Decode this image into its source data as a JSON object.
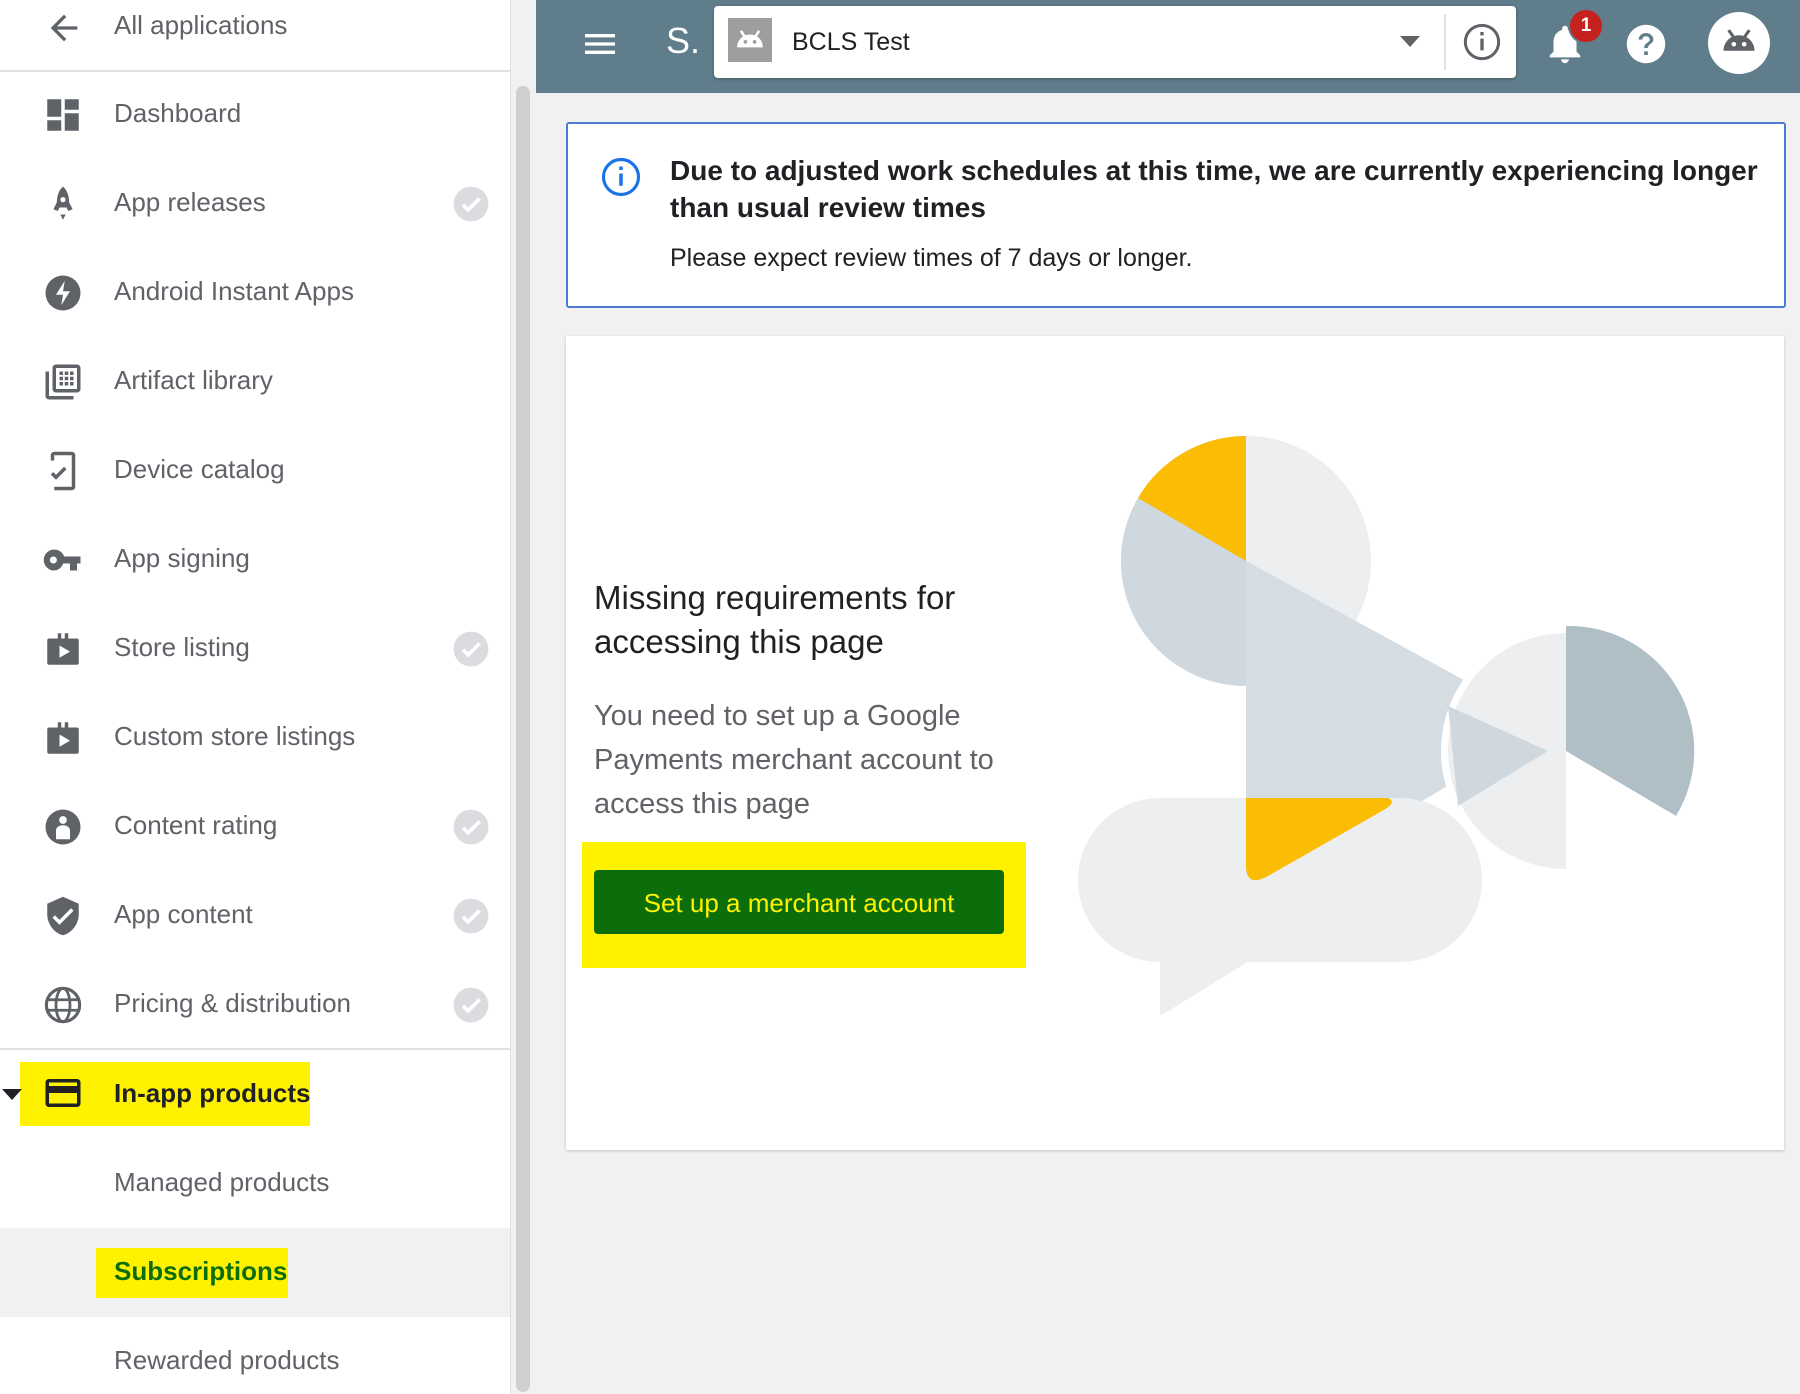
{
  "sidebar": {
    "back_label": "All applications",
    "items": [
      {
        "label": "Dashboard",
        "icon": "dashboard-icon",
        "checked": false
      },
      {
        "label": "App releases",
        "icon": "rocket-icon",
        "checked": true
      },
      {
        "label": "Android Instant Apps",
        "icon": "bolt-icon",
        "checked": false
      },
      {
        "label": "Artifact library",
        "icon": "library-icon",
        "checked": false
      },
      {
        "label": "Device catalog",
        "icon": "device-check-icon",
        "checked": false
      },
      {
        "label": "App signing",
        "icon": "key-icon",
        "checked": false
      },
      {
        "label": "Store listing",
        "icon": "store-icon",
        "checked": true
      },
      {
        "label": "Custom store listings",
        "icon": "store-icon",
        "checked": false
      },
      {
        "label": "Content rating",
        "icon": "child-icon",
        "checked": true
      },
      {
        "label": "App content",
        "icon": "shield-check-icon",
        "checked": true
      },
      {
        "label": "Pricing & distribution",
        "icon": "globe-icon",
        "checked": true
      }
    ],
    "section": {
      "label": "In-app products",
      "icon": "credit-card-icon"
    },
    "sub_items": [
      {
        "label": "Managed products"
      },
      {
        "label": "Subscriptions"
      },
      {
        "label": "Rewarded products"
      }
    ]
  },
  "topbar": {
    "app_short": "S.",
    "app_name": "BCLS Test",
    "notification_count": "1"
  },
  "banner": {
    "title": "Due to adjusted work schedules at this time, we are currently experiencing longer than usual review times",
    "body": "Please expect review times of 7 days or longer."
  },
  "card": {
    "title": "Missing requirements for accessing this page",
    "body": "You need to set up a Google Payments merchant account to access this page",
    "button_label": "Set up a merchant account"
  },
  "colors": {
    "topbar": "#607d8b",
    "highlight": "#fff200",
    "button": "#0b6e0b",
    "accent_yellow": "#fbbc04",
    "info_blue": "#1a73e8"
  }
}
